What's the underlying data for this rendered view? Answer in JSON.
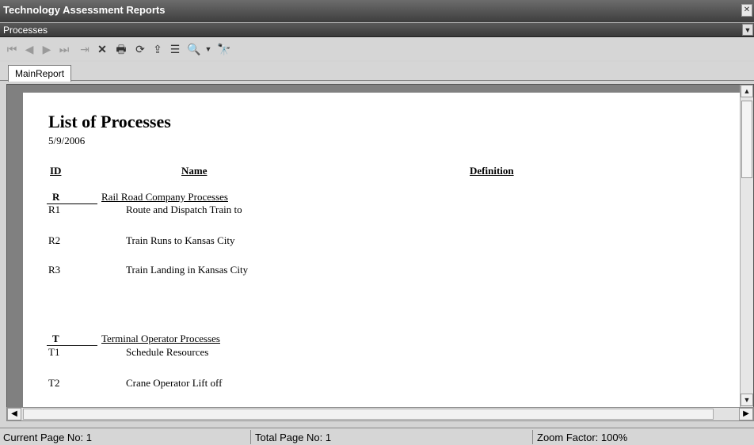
{
  "window": {
    "title": "Technology Assessment Reports"
  },
  "selector": {
    "value": "Processes"
  },
  "toolbar": {
    "icons": [
      "first-page-icon",
      "prev-page-icon",
      "next-page-icon",
      "last-page-icon",
      "goto-page-icon",
      "close-icon",
      "print-icon",
      "refresh-icon",
      "export-icon",
      "group-tree-icon",
      "zoom-icon",
      "dropdown-arrow-icon",
      "search-icon"
    ]
  },
  "tabs": [
    {
      "label": "MainReport"
    }
  ],
  "report": {
    "title": "List of Processes",
    "date": "5/9/2006",
    "headers": {
      "id": "ID",
      "name": "Name",
      "definition": "Definition"
    },
    "groups": [
      {
        "code": "R",
        "name": "Rail Road Company Processes",
        "rows": [
          {
            "id": "R1",
            "name": "Route and Dispatch Train to"
          },
          {
            "id": "R2",
            "name": "Train Runs to Kansas City"
          },
          {
            "id": "R3",
            "name": "Train Landing in Kansas City"
          }
        ]
      },
      {
        "code": "T",
        "name": "Terminal Operator Processes",
        "rows": [
          {
            "id": "T1",
            "name": "Schedule Resources"
          },
          {
            "id": "T2",
            "name": "Crane Operator Lift off"
          }
        ]
      }
    ]
  },
  "status": {
    "current_page": "Current Page No: 1",
    "total_page": "Total Page No: 1",
    "zoom": "Zoom Factor: 100%"
  }
}
